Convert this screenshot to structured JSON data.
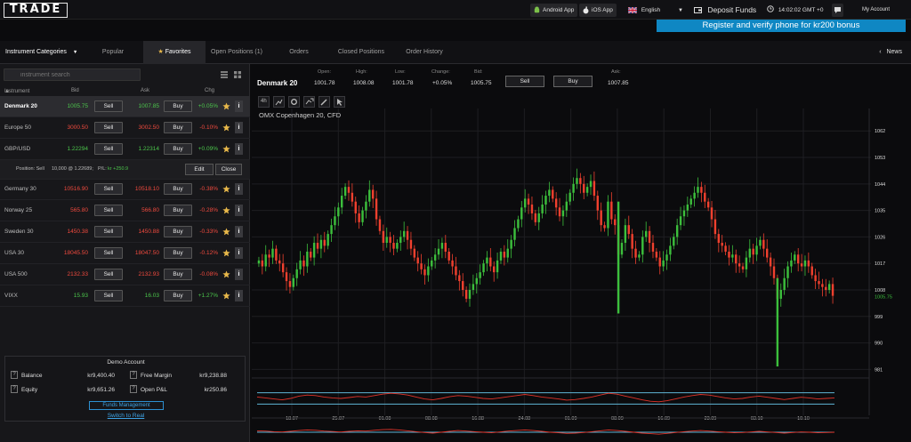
{
  "header": {
    "logo": "TRADE",
    "android_label": "Android App",
    "ios_label": "iOS App",
    "language": "English",
    "deposit_label": "Deposit Funds",
    "time": "14:02:02 GMT +0",
    "account_label": "My Account",
    "register_banner": "Register and verify phone for kr200 bonus"
  },
  "tabs": {
    "categories": "Instrument Categories",
    "items": [
      "Popular",
      "Favorites",
      "Open Positions (1)",
      "Orders",
      "Closed Positions",
      "Order History"
    ],
    "news": "News"
  },
  "left": {
    "search_placeholder": "instrument search",
    "columns": {
      "instrument": "Instrument",
      "bid": "Bid",
      "ask": "Ask",
      "chg": "Chg"
    },
    "sell_label": "Sell",
    "buy_label": "Buy",
    "info_label": "i",
    "instruments": [
      {
        "name": "Denmark 20",
        "bid": "1005.75",
        "ask": "1007.85",
        "chg": "+0.05%",
        "dir": "up"
      },
      {
        "name": "Europe 50",
        "bid": "3000.50",
        "ask": "3002.50",
        "chg": "-0.10%",
        "dir": "down"
      },
      {
        "name": "GBP/USD",
        "bid": "1.22294",
        "ask": "1.22314",
        "chg": "+0.09%",
        "dir": "up"
      },
      {
        "name": "Germany 30",
        "bid": "10516.90",
        "ask": "10518.10",
        "chg": "-0.38%",
        "dir": "down"
      },
      {
        "name": "Norway 25",
        "bid": "565.80",
        "ask": "566.80",
        "chg": "-0.28%",
        "dir": "down"
      },
      {
        "name": "Sweden 30",
        "bid": "1450.38",
        "ask": "1450.88",
        "chg": "-0.33%",
        "dir": "down"
      },
      {
        "name": "USA 30",
        "bid": "18045.50",
        "ask": "18047.50",
        "chg": "-0.12%",
        "dir": "down"
      },
      {
        "name": "USA 500",
        "bid": "2132.33",
        "ask": "2132.93",
        "chg": "-0.08%",
        "dir": "down"
      },
      {
        "name": "VIXX",
        "bid": "15.93",
        "ask": "16.03",
        "chg": "+1.27%",
        "dir": "up"
      }
    ],
    "position": {
      "label": "Position: Sell",
      "detail": "10,000 @ 1.22689;",
      "pl_label": "P/L:",
      "pl_value": "kr +250.9",
      "edit": "Edit",
      "close": "Close"
    },
    "account": {
      "title": "Demo Account",
      "balance_label": "Balance",
      "balance": "kr9,400.40",
      "free_margin_label": "Free Margin",
      "free_margin": "kr9,238.88",
      "equity_label": "Equity",
      "equity": "kr9,651.26",
      "open_pl_label": "Open P&L",
      "open_pl": "kr250.86",
      "funds_management": "Funds Management",
      "switch": "Switch to Real",
      "q": "?"
    }
  },
  "quote": {
    "symbol": "Denmark 20",
    "open_label": "Open:",
    "open": "1001.78",
    "high_label": "High:",
    "high": "1008.08",
    "low_label": "Low:",
    "low": "1001.78",
    "change_label": "Change:",
    "change": "+0.05%",
    "bid_label": "Bid:",
    "bid": "1005.75",
    "ask_label": "Ask:",
    "ask": "1007.85",
    "sell_label": "Sell",
    "buy_label": "Buy"
  },
  "colors": {
    "up": "#3cbf3c",
    "down": "#f0402e",
    "accent": "#0f87c3",
    "indicator_line": "#5fb6d6"
  },
  "chart_data": {
    "type": "candlestick",
    "title": "OMX Copenhagen 20, CFD",
    "y_ticks": [
      1062,
      1053,
      1044,
      1035,
      1026,
      1017,
      1008,
      999,
      990,
      981
    ],
    "ylim": [
      979,
      1066
    ],
    "current_price": "1005.75",
    "x_ticks": [
      "18.07",
      "25.07",
      "01.08",
      "08.08",
      "16.08",
      "24.08",
      "01.09",
      "08.09",
      "16.09",
      "23.09",
      "03.10",
      "10.10"
    ],
    "price_path": [
      1018,
      1016,
      1020,
      1019,
      1022,
      1018,
      1017,
      1014,
      1011,
      1009,
      1012,
      1015,
      1018,
      1016,
      1021,
      1019,
      1024,
      1022,
      1025,
      1023,
      1027,
      1030,
      1033,
      1036,
      1040,
      1043,
      1041,
      1038,
      1034,
      1031,
      1035,
      1038,
      1042,
      1039,
      1032,
      1028,
      1024,
      1026,
      1024,
      1022,
      1024,
      1026,
      1028,
      1025,
      1022,
      1019,
      1017,
      1015,
      1013,
      1016,
      1018,
      1020,
      1022,
      1024,
      1021,
      1018,
      1016,
      1013,
      1011,
      1008,
      1005,
      1008,
      1010,
      1012,
      1014,
      1017,
      1019,
      1016,
      1014,
      1018,
      1021,
      1019,
      1022,
      1025,
      1029,
      1032,
      1036,
      1039,
      1037,
      1034,
      1031,
      1034,
      1037,
      1040,
      1042,
      1039,
      1036,
      1033,
      1035,
      1038,
      1041,
      1044,
      1046,
      1044,
      1041,
      1043,
      1045,
      1040,
      1035,
      1030,
      1029,
      1038,
      1032,
      1030,
      1020,
      1024,
      1030,
      1027,
      1022,
      1019,
      1020,
      1026,
      1028,
      1024,
      1021,
      1019,
      1016,
      1018,
      1020,
      1023,
      1026,
      1030,
      1033,
      1035,
      1037,
      1039,
      1041,
      1043,
      1041,
      1038,
      1036,
      1032,
      1027,
      1024,
      1023,
      1021,
      1019,
      1020,
      1017,
      1016,
      1015,
      1019,
      1022,
      1020,
      1023,
      1025,
      1022,
      1019,
      1016,
      1012,
      1005,
      1008,
      1012,
      1016,
      1018,
      1020,
      1017,
      1016,
      1018,
      1016,
      1013,
      1011,
      1010,
      1009,
      1008,
      1010,
      1006
    ],
    "rsi_levels": [
      70,
      30
    ],
    "rsi": [
      55,
      52,
      48,
      45,
      50,
      58,
      62,
      60,
      55,
      52,
      50,
      53,
      57,
      55,
      60,
      65,
      68,
      66,
      62,
      55,
      48,
      45,
      50,
      56,
      60,
      58,
      54,
      50,
      48,
      52,
      56,
      60,
      64,
      60,
      55,
      52,
      48,
      44,
      46,
      50,
      55,
      62,
      68,
      65,
      58,
      52,
      45,
      40,
      38,
      42,
      48,
      55,
      60,
      64,
      62,
      57,
      52,
      48,
      50,
      55,
      58,
      54,
      50,
      46,
      50,
      54,
      52,
      48,
      50,
      52
    ],
    "momentum": [
      60,
      58,
      54,
      52,
      56,
      62,
      66,
      64,
      58,
      55,
      52,
      56,
      60,
      58,
      64,
      68,
      70,
      66,
      60,
      54,
      48,
      44,
      50,
      56,
      62,
      58,
      54,
      50,
      46,
      52,
      58,
      62,
      66,
      62,
      56,
      50,
      46,
      42,
      44,
      48,
      54,
      60,
      66,
      62,
      56,
      50,
      44,
      40,
      36,
      42,
      48,
      54,
      58,
      62,
      58,
      54,
      50,
      46,
      48,
      52,
      56,
      52,
      48,
      44,
      48,
      52,
      50,
      46,
      48,
      50
    ]
  }
}
